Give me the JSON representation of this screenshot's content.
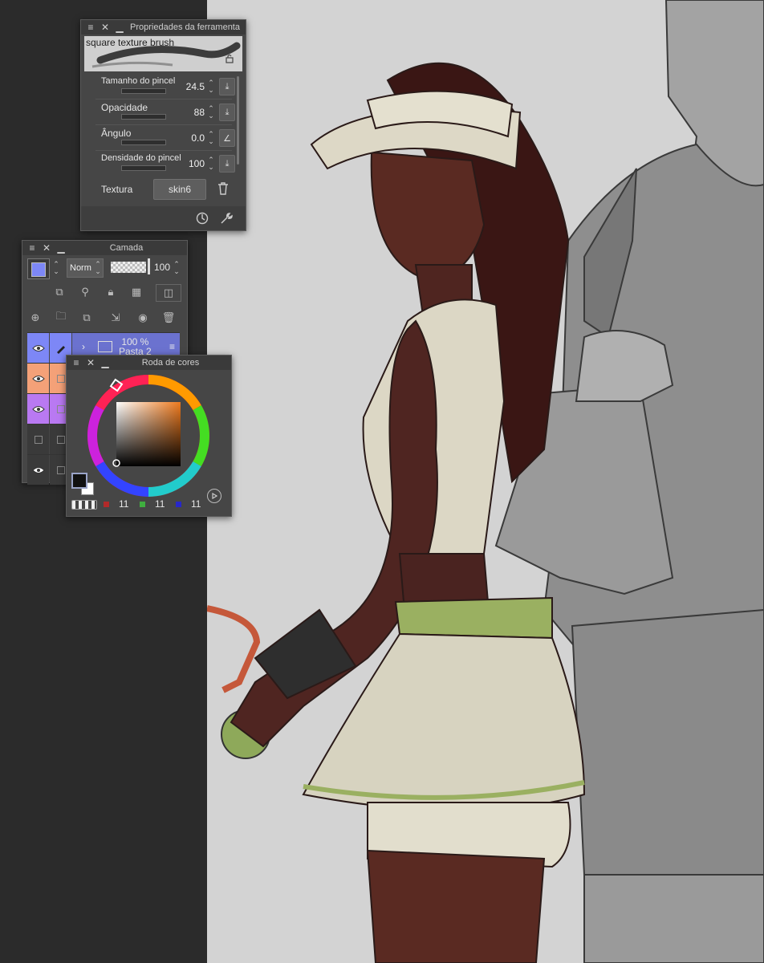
{
  "tool_properties": {
    "title": "Propriedades da ferramenta",
    "brush_name": "square texture brush",
    "props": [
      {
        "label": "Tamanho do pincel",
        "value": "24.5"
      },
      {
        "label": "Opacidade",
        "value": "88"
      },
      {
        "label": "Ângulo",
        "value": "0.0"
      },
      {
        "label": "Densidade do pincel",
        "value": "100"
      }
    ],
    "texture_label": "Textura",
    "texture_value": "skin6"
  },
  "layer_panel": {
    "title": "Camada",
    "blend_mode": "Norm",
    "opacity": "100",
    "layer_color": "#7d87f6",
    "folder_opacity": "100 %",
    "folder_name": "Pasta 2",
    "row_colors": [
      "#7d87f6",
      "#f4a178",
      "#b979f2",
      "#3a3a3a",
      "#3a3a3a"
    ]
  },
  "color_wheel": {
    "title": "Roda de cores",
    "fg_color": "#111111",
    "bg_color": "#ffffff",
    "r": "11",
    "g": "11",
    "b": "11"
  },
  "icons": [
    "menu-icon",
    "close-icon",
    "minimize-icon",
    "lock-icon",
    "download-icon",
    "trash-icon",
    "reset-icon",
    "wrench-icon",
    "eye-icon",
    "pencil-icon",
    "folder-icon",
    "play-icon"
  ]
}
